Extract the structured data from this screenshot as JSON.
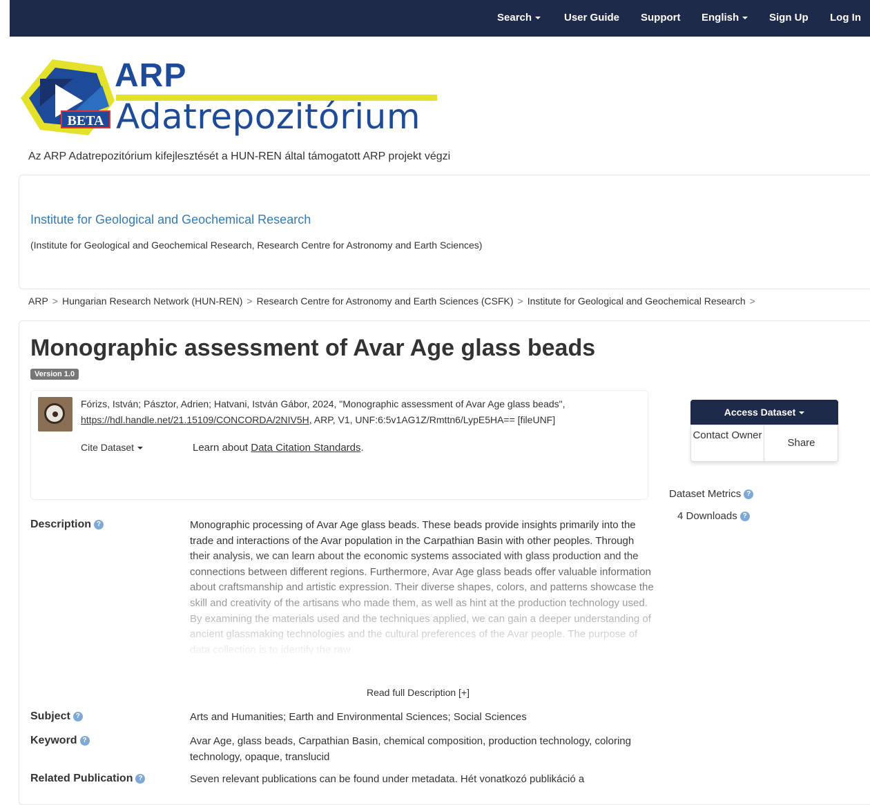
{
  "nav": {
    "search": "Search",
    "user_guide": "User Guide",
    "support": "Support",
    "language": "English",
    "sign_up": "Sign Up",
    "log_in": "Log In"
  },
  "logo": {
    "arp": "ARP",
    "name": "Adatrepozitórium",
    "beta": "BETA"
  },
  "tagline": "Az ARP Adatrepozitórium kifejlesztését a HUN-REN által támogatott ARP projekt végzi",
  "institution": {
    "name": "Institute for Geological and Geochemical Research",
    "affiliation": "(Institute for Geological and Geochemical Research, Research Centre for Astronomy and Earth Sciences)"
  },
  "breadcrumb": [
    "ARP",
    "Hungarian Research Network (HUN-REN)",
    "Research Centre for Astronomy and Earth Sciences (CSFK)",
    "Institute for Geological and Geochemical Research"
  ],
  "dataset": {
    "title": "Monographic assessment of Avar Age glass beads",
    "version": "Version 1.0",
    "citation_authors": "Fórizs, István; Pásztor, Adrien; Hatvani, István Gábor, 2024, \"Monographic assessment of Avar Age glass beads\", ",
    "citation_link": "https://hdl.handle.net/21.15109/CONCORDA/2NIV5H",
    "citation_rest": ", ARP, V1, UNF:6:5v1AG1Z/Rmttn6/LypE5HA== [fileUNF]",
    "cite_button": "Cite Dataset",
    "learn_prefix": "Learn about ",
    "learn_link": "Data Citation Standards",
    "learn_suffix": "."
  },
  "actions": {
    "access": "Access Dataset",
    "contact": "Contact Owner",
    "share": "Share"
  },
  "metrics": {
    "title": "Dataset Metrics",
    "downloads": "4 Downloads"
  },
  "metadata": {
    "description_label": "Description",
    "description": "Monographic processing of Avar Age glass beads. These beads provide insights primarily into the trade and interactions of the Avar population in the Carpathian Basin with other peoples. Through their analysis, we can learn about the economic systems associated with glass production and the connections between different regions. Furthermore, Avar Age glass beads offer valuable information about craftsmanship and artistic expression. Their diverse shapes, colors, and patterns showcase the skill and creativity of the artisans who made them, as well as hint at the production technology used. By examining the materials used and the techniques applied, we can gain a deeper understanding of ancient glassmaking technologies and the cultural preferences of the Avar people. The purpose of data collection is to identify the raw",
    "read_more": "Read full Description [+]",
    "subject_label": "Subject",
    "subject": "Arts and Humanities; Earth and Environmental Sciences; Social Sciences",
    "keyword_label": "Keyword",
    "keyword": "Avar Age, glass beads, Carpathian Basin, chemical composition, production technology, coloring technology, opaque, translucid",
    "related_label": "Related Publication",
    "related": "Seven relevant publications can be found under metadata. Hét vonatkozó publikáció a"
  },
  "colors": {
    "navbar": "#1e2a4a",
    "logo_blue": "#1e4a9a",
    "logo_yellow": "#e4e12a",
    "link": "#337ab7"
  }
}
